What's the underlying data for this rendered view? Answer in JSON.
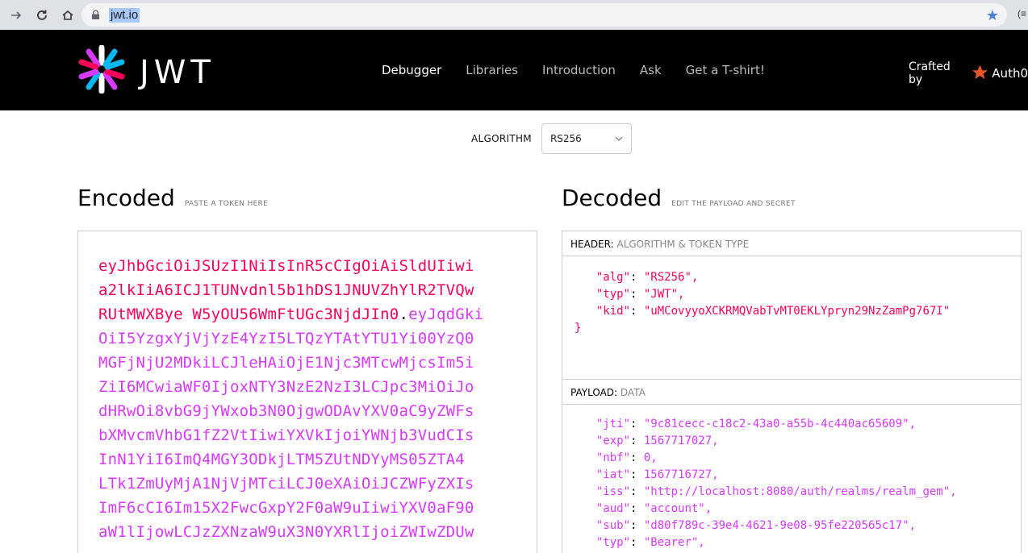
{
  "browser": {
    "url": "jwt.io",
    "extension_glyph": "(≡"
  },
  "site": {
    "wordmark": "JWT",
    "menu": [
      "Debugger",
      "Libraries",
      "Introduction",
      "Ask",
      "Get a T-shirt!"
    ],
    "crafted_by": "Crafted by",
    "brand": "Auth0"
  },
  "algorithm": {
    "label": "ALGORITHM",
    "selected": "RS256"
  },
  "encoded": {
    "title": "Encoded",
    "subtitle": "PASTE A TOKEN HERE",
    "lines": [
      {
        "header": "eyJhbGciOiJSUzI1NiIsInR5cCIgOiAiSldUIiwi",
        "payload": ""
      },
      {
        "header": "a2lkIiA6ICJ1TUNvdnl5b1hDS1JNUVZhYlR2TVQw",
        "payload": ""
      },
      {
        "header": "RUtMWXBye W5yOU56WmFtUGc3NjdJIn0",
        "payload": "eyJqdGki"
      },
      {
        "header": "",
        "payload": "OiI5YzgxYjVjYzE4YzI5LTQzYTAtYTU1Yi00YzQ0"
      },
      {
        "header": "",
        "payload": "MGFjNjU2MDkiLCJleHAiOjE1Njc3MTcwMjcsIm5i"
      },
      {
        "header": "",
        "payload": "ZiI6MCwiaWF0IjoxNTY3NzE2NzI3LCJpc3MiOiJo"
      },
      {
        "header": "",
        "payload": "dHRwOi8vbG9jYWxob3N0OjgwODAvYXV0aC9yZWFs"
      },
      {
        "header": "",
        "payload": "bXMvcmVhbG1fZ2VtIiwiYXVkIjoiYWNjb3VudCIs"
      },
      {
        "header": "",
        "payload": "InN1YiI6ImQ4MGY3ODkjLTM5ZUtNDYyMS05ZTA4"
      },
      {
        "header": "",
        "payload": "LTk1ZmUyMjA1NjVjMTciLCJ0eXAiOiJCZWFyZXIs"
      },
      {
        "header": "",
        "payload": "ImF6cCI6Im15X2FwcGxpY2F0aW9uIiwiYXV0aF90"
      },
      {
        "header": "",
        "payload": "aW1lIjowLCJzZXNzaW9uX3N0YXRlIjoiZWIwZDUw"
      }
    ]
  },
  "decoded": {
    "title": "Decoded",
    "subtitle": "EDIT THE PAYLOAD AND SECRET",
    "header_section": {
      "label": "HEADER:",
      "desc": "ALGORITHM & TOKEN TYPE"
    },
    "header_json": [
      {
        "key": "\"alg\"",
        "value": "\"RS256\","
      },
      {
        "key": "\"typ\"",
        "value": "\"JWT\","
      },
      {
        "key": "\"kid\"",
        "value": "\"uMCovyyoXCKRMQVabTvMT0EKLYpryn29NzZamPg767I\""
      }
    ],
    "payload_section": {
      "label": "PAYLOAD:",
      "desc": "DATA"
    },
    "payload_json": [
      {
        "key": "\"jti\"",
        "value": "\"9c81cecc-c18c2-43a0-a55b-4c440ac65609\","
      },
      {
        "key": "\"exp\"",
        "value": "1567717027,"
      },
      {
        "key": "\"nbf\"",
        "value": "0,"
      },
      {
        "key": "\"iat\"",
        "value": "1567716727,"
      },
      {
        "key": "\"iss\"",
        "value": "\"http://localhost:8080/auth/realms/realm_gem\","
      },
      {
        "key": "\"aud\"",
        "value": "\"account\","
      },
      {
        "key": "\"sub\"",
        "value": "\"d80f789c-39e4-4621-9e08-95fe220565c17\","
      },
      {
        "key": "\"typ\"",
        "value": "\"Bearer\","
      }
    ]
  }
}
